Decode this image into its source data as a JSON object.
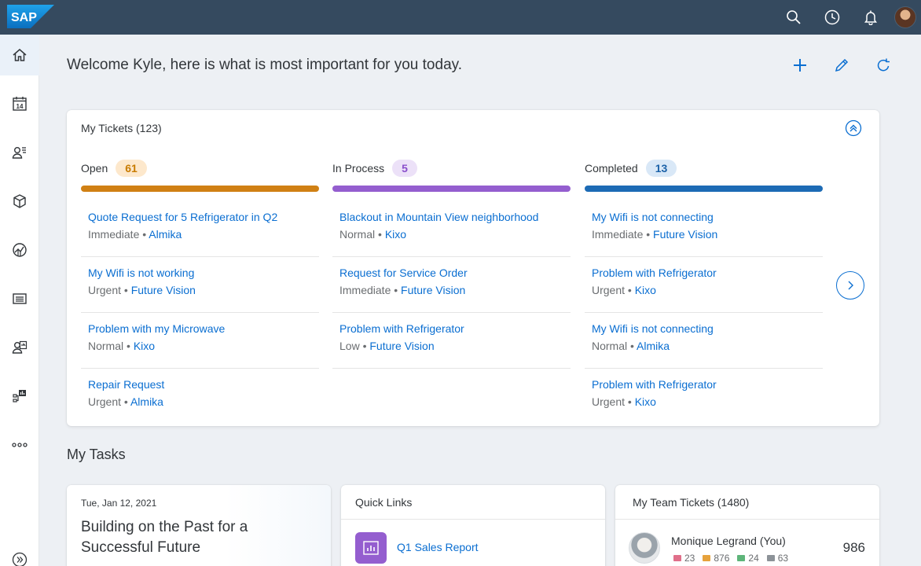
{
  "shell": {
    "logo_text": "SAP",
    "icons": [
      "search-icon",
      "history-icon",
      "notification-icon",
      "user-avatar"
    ]
  },
  "sidenav": {
    "items": [
      "home-icon",
      "calendar-icon",
      "customers-icon",
      "products-icon",
      "analytics-icon",
      "list-icon",
      "contact-transfer-icon",
      "hierarchy-icon",
      "more-icon",
      "expand-icon"
    ],
    "calendar_day": "14"
  },
  "header": {
    "welcome": "Welcome Kyle, here is what is most important for you today.",
    "actions": [
      "add-icon",
      "edit-icon",
      "refresh-icon"
    ]
  },
  "tickets": {
    "title": "My Tickets (123)",
    "columns": [
      {
        "label": "Open",
        "count": "61",
        "colors": {
          "bar": "#d08014",
          "pill_bg": "#fde8cc",
          "pill_fg": "#c87b00"
        },
        "items": [
          {
            "title": "Quote Request for 5 Refrigerator in Q2",
            "priority": "Immediate",
            "account": "Almika"
          },
          {
            "title": "My Wifi is not working",
            "priority": "Urgent",
            "account": "Future Vision"
          },
          {
            "title": "Problem with my Microwave",
            "priority": "Normal",
            "account": "Kixo"
          },
          {
            "title": "Repair Request",
            "priority": "Urgent",
            "account": "Almika"
          }
        ]
      },
      {
        "label": "In Process",
        "count": "5",
        "colors": {
          "bar": "#945ecf",
          "pill_bg": "#ece1f8",
          "pill_fg": "#8a4fcc"
        },
        "items": [
          {
            "title": "Blackout in Mountain View neighborhood",
            "priority": "Normal",
            "account": "Kixo"
          },
          {
            "title": "Request for Service Order",
            "priority": "Immediate",
            "account": "Future Vision"
          },
          {
            "title": "Problem with Refrigerator",
            "priority": "Low",
            "account": "Future Vision"
          }
        ]
      },
      {
        "label": "Completed",
        "count": "13",
        "colors": {
          "bar": "#1d6bb5",
          "pill_bg": "#d9e8f7",
          "pill_fg": "#1c62a8"
        },
        "items": [
          {
            "title": "My Wifi is not connecting",
            "priority": "Immediate",
            "account": "Future Vision"
          },
          {
            "title": "Problem with Refrigerator",
            "priority": "Urgent",
            "account": "Kixo"
          },
          {
            "title": "My Wifi is not connecting",
            "priority": "Normal",
            "account": "Almika"
          },
          {
            "title": "Problem with Refrigerator",
            "priority": "Urgent",
            "account": "Kixo"
          }
        ]
      }
    ]
  },
  "tasks": {
    "section_title": "My Tasks",
    "card": {
      "date": "Tue, Jan 12,  2021",
      "title": "Building on the Past for a Successful Future"
    }
  },
  "quick_links": {
    "title": "Quick Links",
    "items": [
      {
        "label": "Q1 Sales Report",
        "icon": "report-icon",
        "color": "#945ecf"
      }
    ]
  },
  "team_tickets": {
    "title": "My Team Tickets (1480)",
    "member": {
      "name": "Monique Legrand (You)",
      "total": "986",
      "stats": [
        {
          "value": "23",
          "color": "#e06f8a"
        },
        {
          "value": "876",
          "color": "#e6a23c"
        },
        {
          "value": "24",
          "color": "#5eb57a"
        },
        {
          "value": "63",
          "color": "#8c9298"
        }
      ]
    }
  }
}
